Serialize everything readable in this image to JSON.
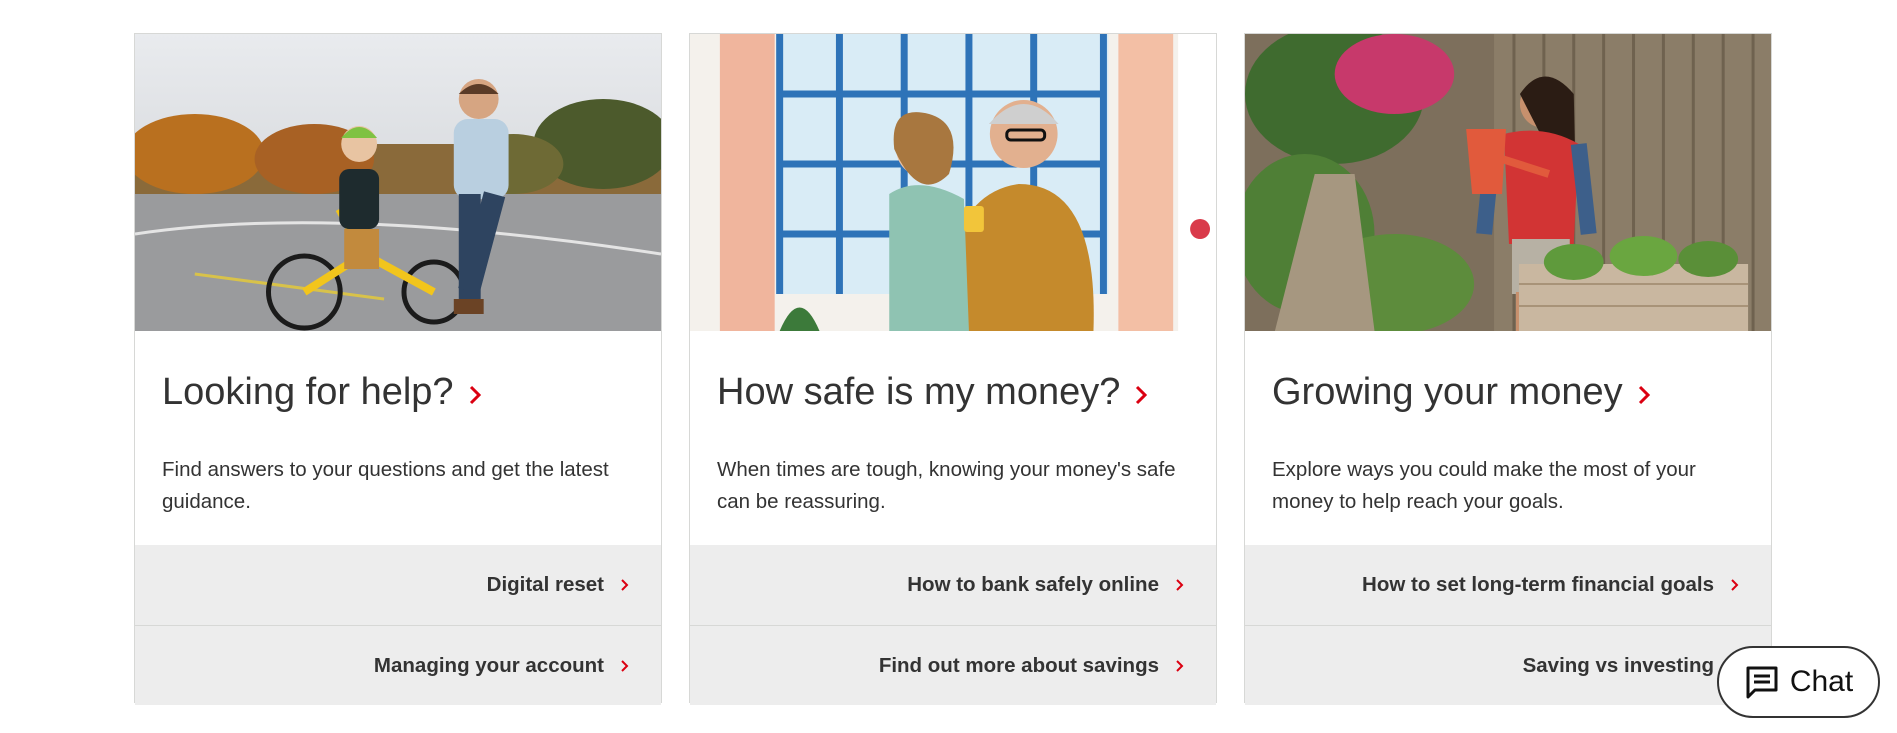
{
  "colors": {
    "accent_red": "#db0011",
    "text": "#333333",
    "link_bg": "#ededed",
    "border": "#d7d8d6"
  },
  "cards": [
    {
      "image_icon": "father-teaching-child-to-ride-bike-photo",
      "title": "Looking for help?",
      "description": "Find answers to your questions and get the latest guidance.",
      "links": [
        "Digital reset",
        "Managing your account"
      ]
    },
    {
      "image_icon": "grandfather-holding-child-photo",
      "title": "How safe is my money?",
      "description": "When times are tough, knowing your money's safe can be reassuring.",
      "links": [
        "How to bank safely online",
        "Find out more about savings"
      ]
    },
    {
      "image_icon": "woman-watering-garden-photo",
      "title": "Growing your money",
      "description": "Explore ways you could make the most of your money to help reach your goals.",
      "links": [
        "How to set long-term financial goals",
        "Saving vs investing"
      ]
    }
  ],
  "chat": {
    "label": "Chat",
    "icon": "chat-bubble-icon"
  }
}
